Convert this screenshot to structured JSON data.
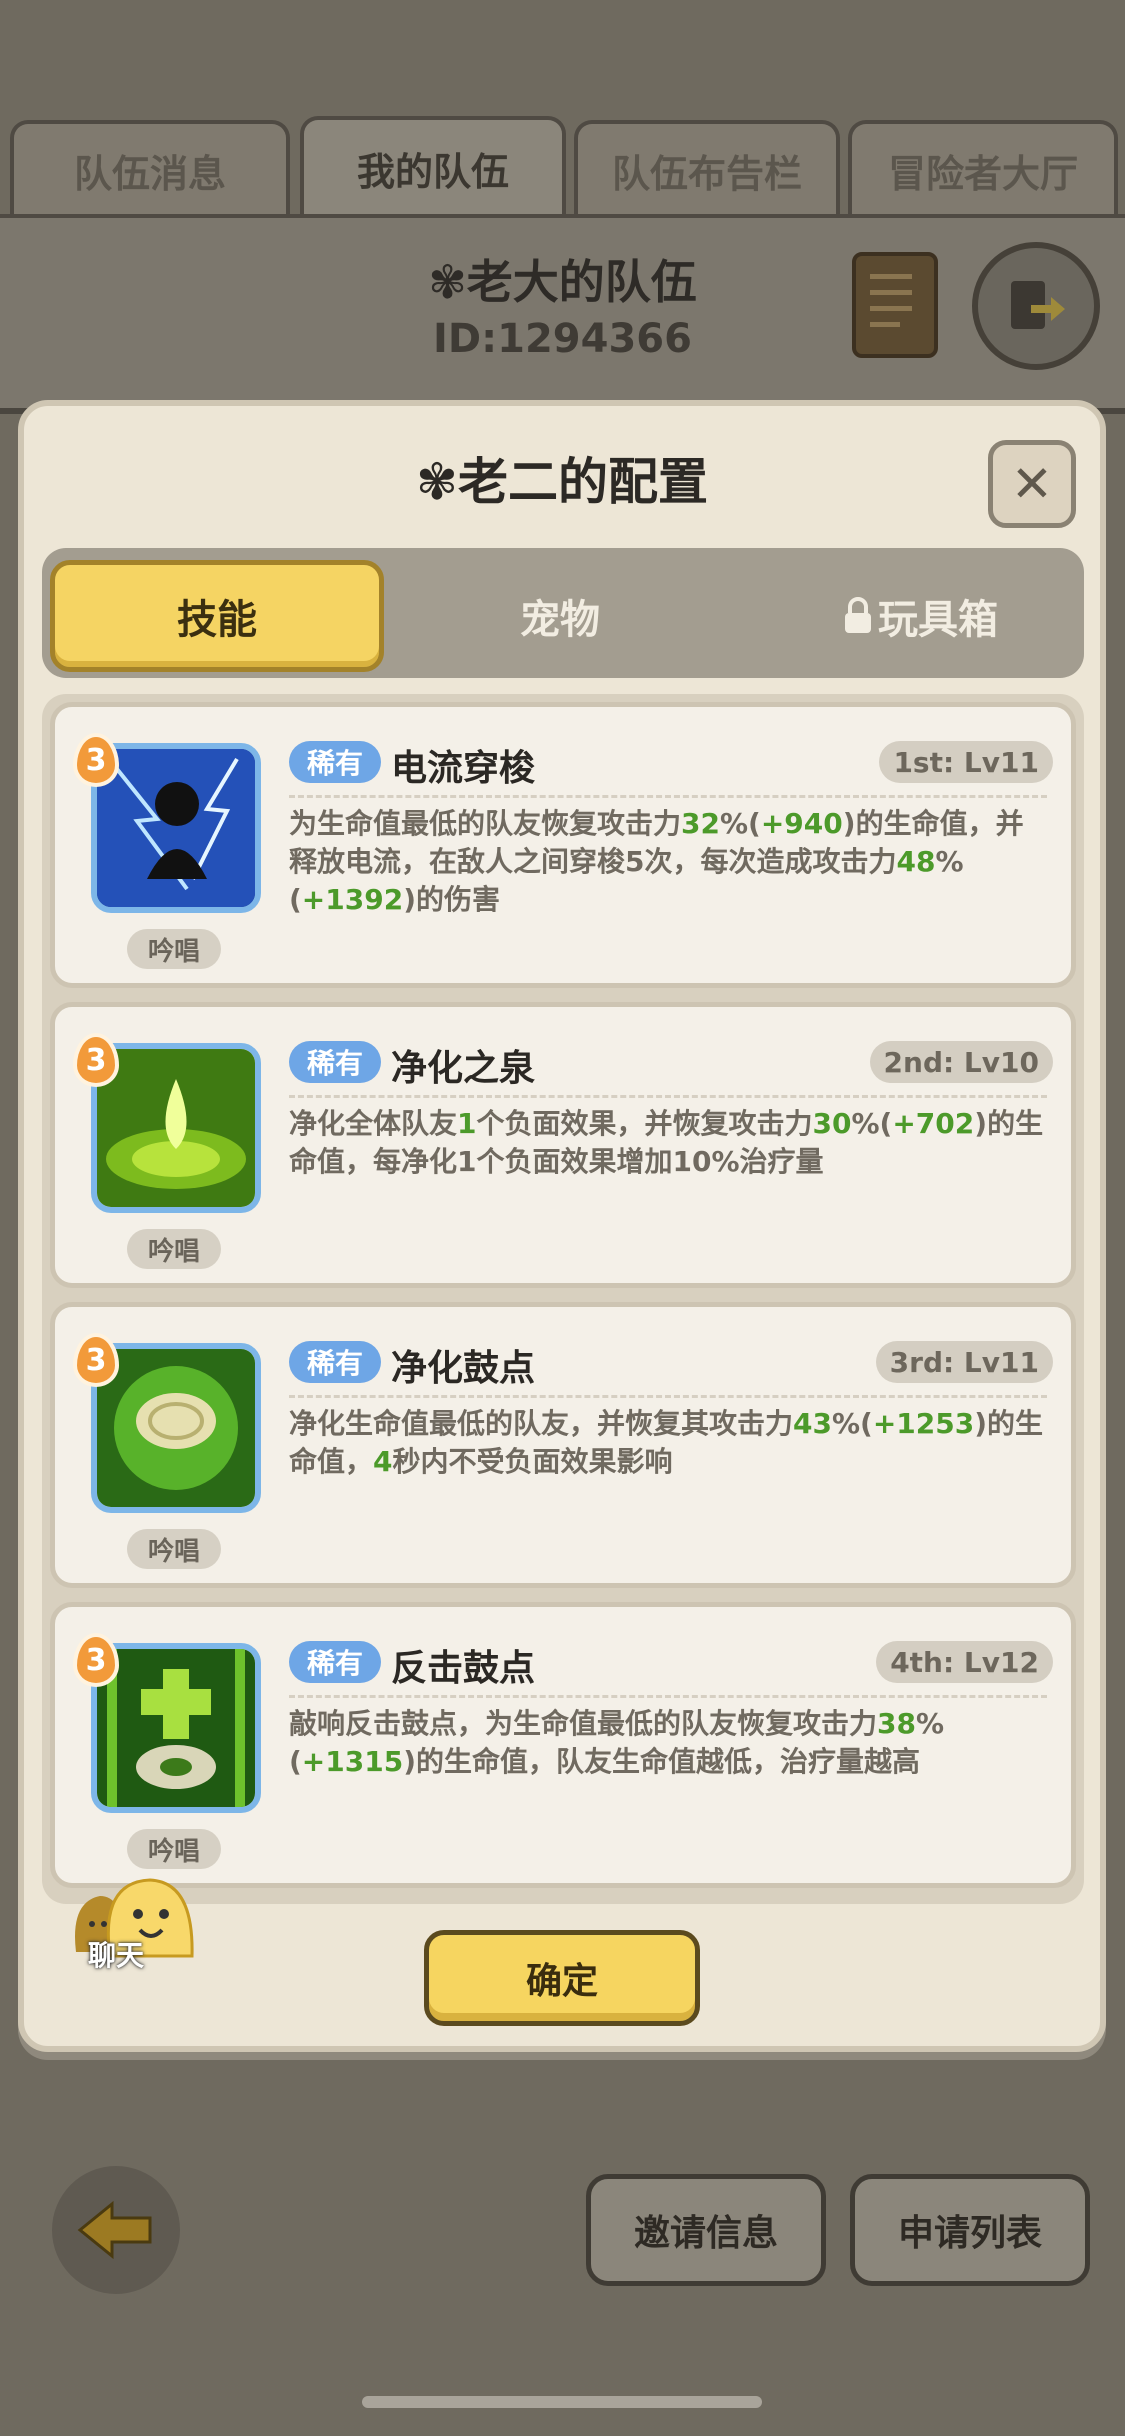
{
  "team_tabs": [
    "队伍消息",
    "我的队伍",
    "队伍布告栏",
    "冒险者大厅"
  ],
  "team": {
    "name": "✾老大的队伍",
    "id": "ID:1294366"
  },
  "modal": {
    "title": "✾老二的配置",
    "close_label": "✕",
    "tabs": [
      "技能",
      "宠物",
      "玩具箱"
    ],
    "confirm_label": "确定"
  },
  "skills": [
    {
      "level": "3",
      "cast": "吟唱",
      "rarity": "稀有",
      "name": "电流穿梭",
      "slot": "1st: Lv11",
      "desc": [
        "为生命值最低的队友恢复攻击力",
        "32",
        "%(",
        "+940",
        ")的生命值，并释放电流，在敌人之间穿梭5次，每次造成攻击力",
        "48",
        "%(",
        "+1392",
        ")的伤害"
      ]
    },
    {
      "level": "3",
      "cast": "吟唱",
      "rarity": "稀有",
      "name": "净化之泉",
      "slot": "2nd: Lv10",
      "desc": [
        "净化全体队友",
        "1",
        "个负面效果，并恢复攻击力",
        "30",
        "%(",
        "+702",
        ")的生命值，每净化1个负面效果增加10%治疗量"
      ]
    },
    {
      "level": "3",
      "cast": "吟唱",
      "rarity": "稀有",
      "name": "净化鼓点",
      "slot": "3rd: Lv11",
      "desc": [
        "净化生命值最低的队友，并恢复其攻击力",
        "43",
        "%(",
        "+1253",
        ")的生命值，",
        "4",
        "秒内不受负面效果影响"
      ]
    },
    {
      "level": "3",
      "cast": "吟唱",
      "rarity": "稀有",
      "name": "反击鼓点",
      "slot": "4th: Lv12",
      "desc": [
        "敲响反击鼓点，为生命值最低的队友恢复攻击力",
        "38",
        "%(",
        "+1315",
        ")的生命值，队友生命值越低，治疗量越高"
      ]
    }
  ],
  "chat_label": "聊天",
  "bottom": {
    "invite_label": "邀请信息",
    "apply_label": "申请列表"
  },
  "colors": {
    "accent_yellow": "#f6d560",
    "rarity_blue": "#6ea6e6",
    "value_green": "#4c9a2a"
  },
  "icons": [
    "lightning-skill-icon",
    "spring-skill-icon",
    "drum-skill-icon",
    "counter-drum-skill-icon"
  ]
}
